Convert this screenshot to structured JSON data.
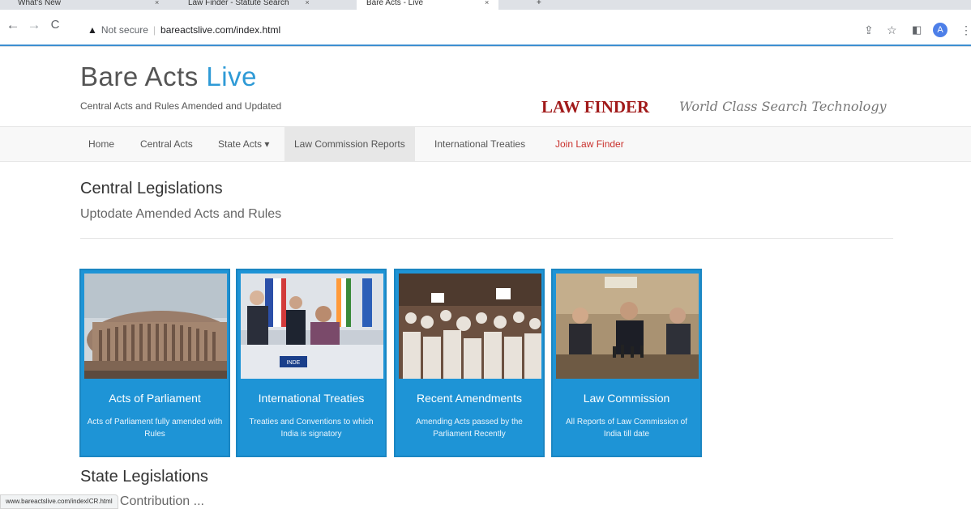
{
  "browser": {
    "tabs": [
      {
        "label": "What's New",
        "close": "×"
      },
      {
        "label": "Law Finder - Statute Search",
        "close": "×"
      },
      {
        "label": "Bare Acts - Live",
        "close": "×"
      }
    ],
    "new_tab": "+",
    "security_label": "Not secure",
    "url": "bareactslive.com/index.html",
    "profile_initial": "A",
    "status_url": "www.bareactslive.com/indexICR.html"
  },
  "header": {
    "title_main": "Bare Acts",
    "title_accent": "Live",
    "tagline": "Central Acts and Rules Amended and Updated",
    "law_finder": "LAW FINDER",
    "slogan": "World Class Search Technology"
  },
  "nav": {
    "items": [
      {
        "label": "Home"
      },
      {
        "label": "Central Acts"
      },
      {
        "label": "State Acts ▾"
      },
      {
        "label": "Law Commission Reports"
      },
      {
        "label": "International Treaties"
      },
      {
        "label": "Join Law Finder"
      }
    ]
  },
  "central": {
    "title": "Central Legislations",
    "subtitle": "Uptodate Amended Acts and Rules"
  },
  "cards": [
    {
      "title": "Acts of Parliament",
      "desc": "Acts of Parliament fully amended with Rules"
    },
    {
      "title": "International Treaties",
      "desc": "Treaties and Conventions to which India is signatory",
      "placard": "INDE"
    },
    {
      "title": "Recent Amendments",
      "desc": "Amending Acts passed by the Parliament Recently"
    },
    {
      "title": "Law Commission",
      "desc": "All Reports of Law Commission of India till date"
    }
  ],
  "state": {
    "title": "State Legislations",
    "subtitle": "h your Contribution ..."
  },
  "colors": {
    "accent": "#2e9ad6",
    "card_bg": "#1e94d6",
    "law_finder": "#a11a1a",
    "join_link": "#c9302c"
  }
}
